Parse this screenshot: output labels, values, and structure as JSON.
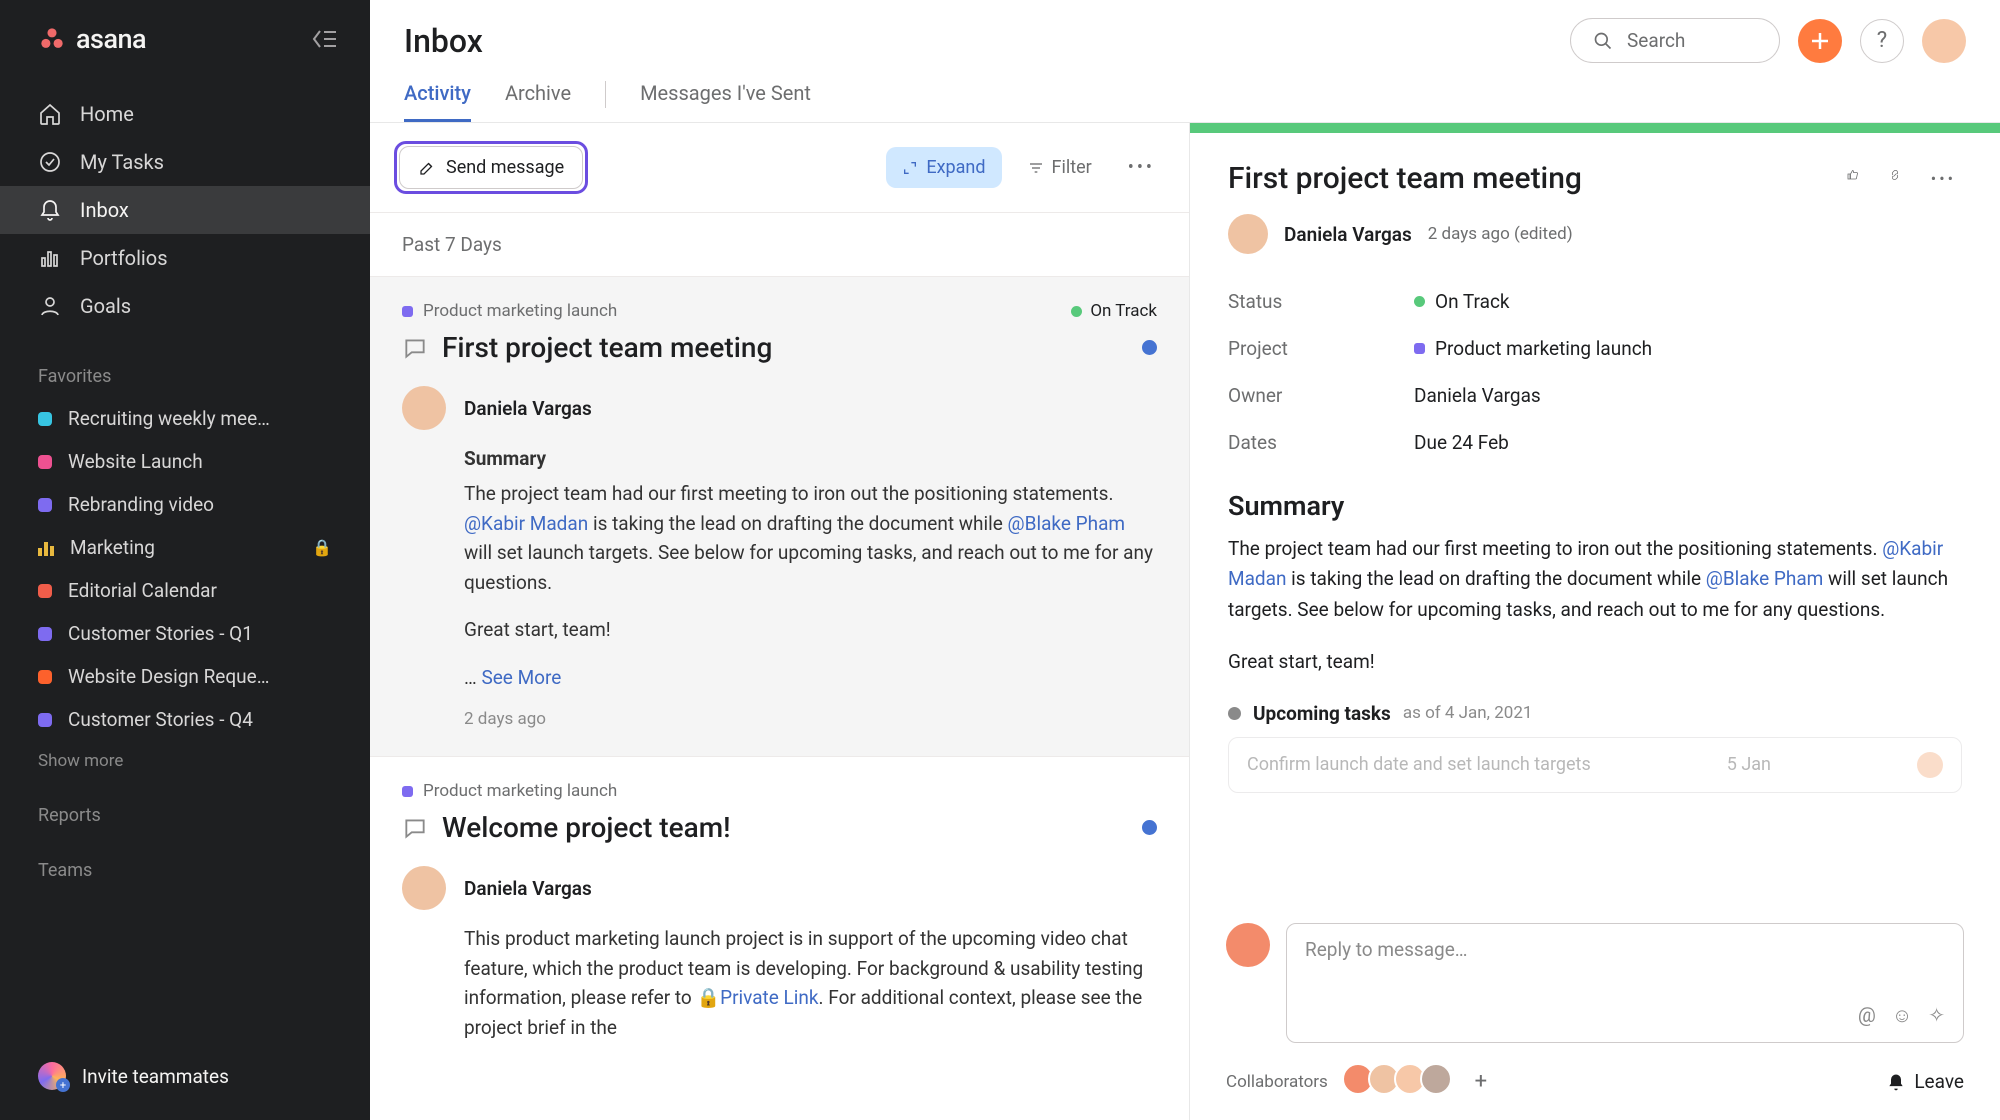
{
  "app": {
    "name": "asana"
  },
  "sidebar": {
    "nav": [
      {
        "label": "Home"
      },
      {
        "label": "My Tasks"
      },
      {
        "label": "Inbox"
      },
      {
        "label": "Portfolios"
      },
      {
        "label": "Goals"
      }
    ],
    "favorites_label": "Favorites",
    "favorites": [
      {
        "label": "Recruiting weekly mee…",
        "color": "#37c5e2"
      },
      {
        "label": "Website Launch",
        "color": "#ee5191"
      },
      {
        "label": "Rebranding video",
        "color": "#7e6bf0"
      },
      {
        "label": "Marketing",
        "bars": true,
        "locked": true
      },
      {
        "label": "Editorial Calendar",
        "color": "#f05d4a"
      },
      {
        "label": "Customer Stories - Q1",
        "color": "#7e6bf0"
      },
      {
        "label": "Website Design Reque…",
        "color": "#fd612c"
      },
      {
        "label": "Customer Stories - Q4",
        "color": "#7e6bf0"
      }
    ],
    "show_more": "Show more",
    "reports_label": "Reports",
    "teams_label": "Teams",
    "invite_label": "Invite teammates"
  },
  "header": {
    "title": "Inbox",
    "tabs": [
      {
        "label": "Activity",
        "active": true
      },
      {
        "label": "Archive"
      },
      {
        "label": "Messages I've Sent"
      }
    ],
    "search_placeholder": "Search"
  },
  "toolbar": {
    "send_message": "Send message",
    "expand": "Expand",
    "filter": "Filter"
  },
  "group_label": "Past 7 Days",
  "items": [
    {
      "project": "Product marketing launch",
      "project_color": "#7e6bf0",
      "status": "On Track",
      "status_color": "#58c97b",
      "title": "First project team meeting",
      "author": "Daniela Vargas",
      "summary_heading": "Summary",
      "body_pre": "The project team had our first meeting to iron out the positioning statements. ",
      "mention1": "@Kabir Madan",
      "body_mid": " is taking the lead on drafting the document while ",
      "mention2": "@Blake Pham",
      "body_post": " will set launch targets. See below for upcoming tasks, and reach out to me for any questions.",
      "body_sig": "Great start, team!",
      "see_more_prefix": "…",
      "see_more": "See More",
      "time": "2 days ago"
    },
    {
      "project": "Product marketing launch",
      "project_color": "#7e6bf0",
      "title": "Welcome project team!",
      "author": "Daniela Vargas",
      "body_pre": "This product marketing launch project is in support of the upcoming video chat feature, which the product team is developing. For background & usability testing information, please refer to ",
      "link1": "Private Link",
      "body_post": ". For additional context, please see the project brief in the"
    }
  ],
  "detail": {
    "title": "First project team meeting",
    "author": "Daniela Vargas",
    "meta": "2 days ago  (edited)",
    "fields": {
      "status_label": "Status",
      "status_value": "On Track",
      "status_color": "#58c97b",
      "project_label": "Project",
      "project_value": "Product marketing launch",
      "project_color": "#7e6bf0",
      "owner_label": "Owner",
      "owner_value": "Daniela Vargas",
      "dates_label": "Dates",
      "dates_value": "Due 24 Feb"
    },
    "summary_heading": "Summary",
    "body_pre": "The project team had our first meeting to iron out the positioning statements. ",
    "mention1": "@Kabir Madan",
    "body_mid": " is taking the lead on drafting the document while ",
    "mention2": "@Blake Pham",
    "body_post": " will set launch targets. See below for upcoming tasks, and reach out to me for any questions.",
    "body_sig": "Great start, team!",
    "upcoming_label": "Upcoming tasks",
    "upcoming_asof": "as of 4 Jan, 2021",
    "task_title": "Confirm launch date and set launch targets",
    "task_date": "5 Jan",
    "reply_placeholder": "Reply to message…",
    "collaborators_label": "Collaborators",
    "collaborator_colors": [
      "#f38b6b",
      "#efc3a3",
      "#f7c8a8",
      "#bea89c"
    ],
    "leave_label": "Leave"
  }
}
